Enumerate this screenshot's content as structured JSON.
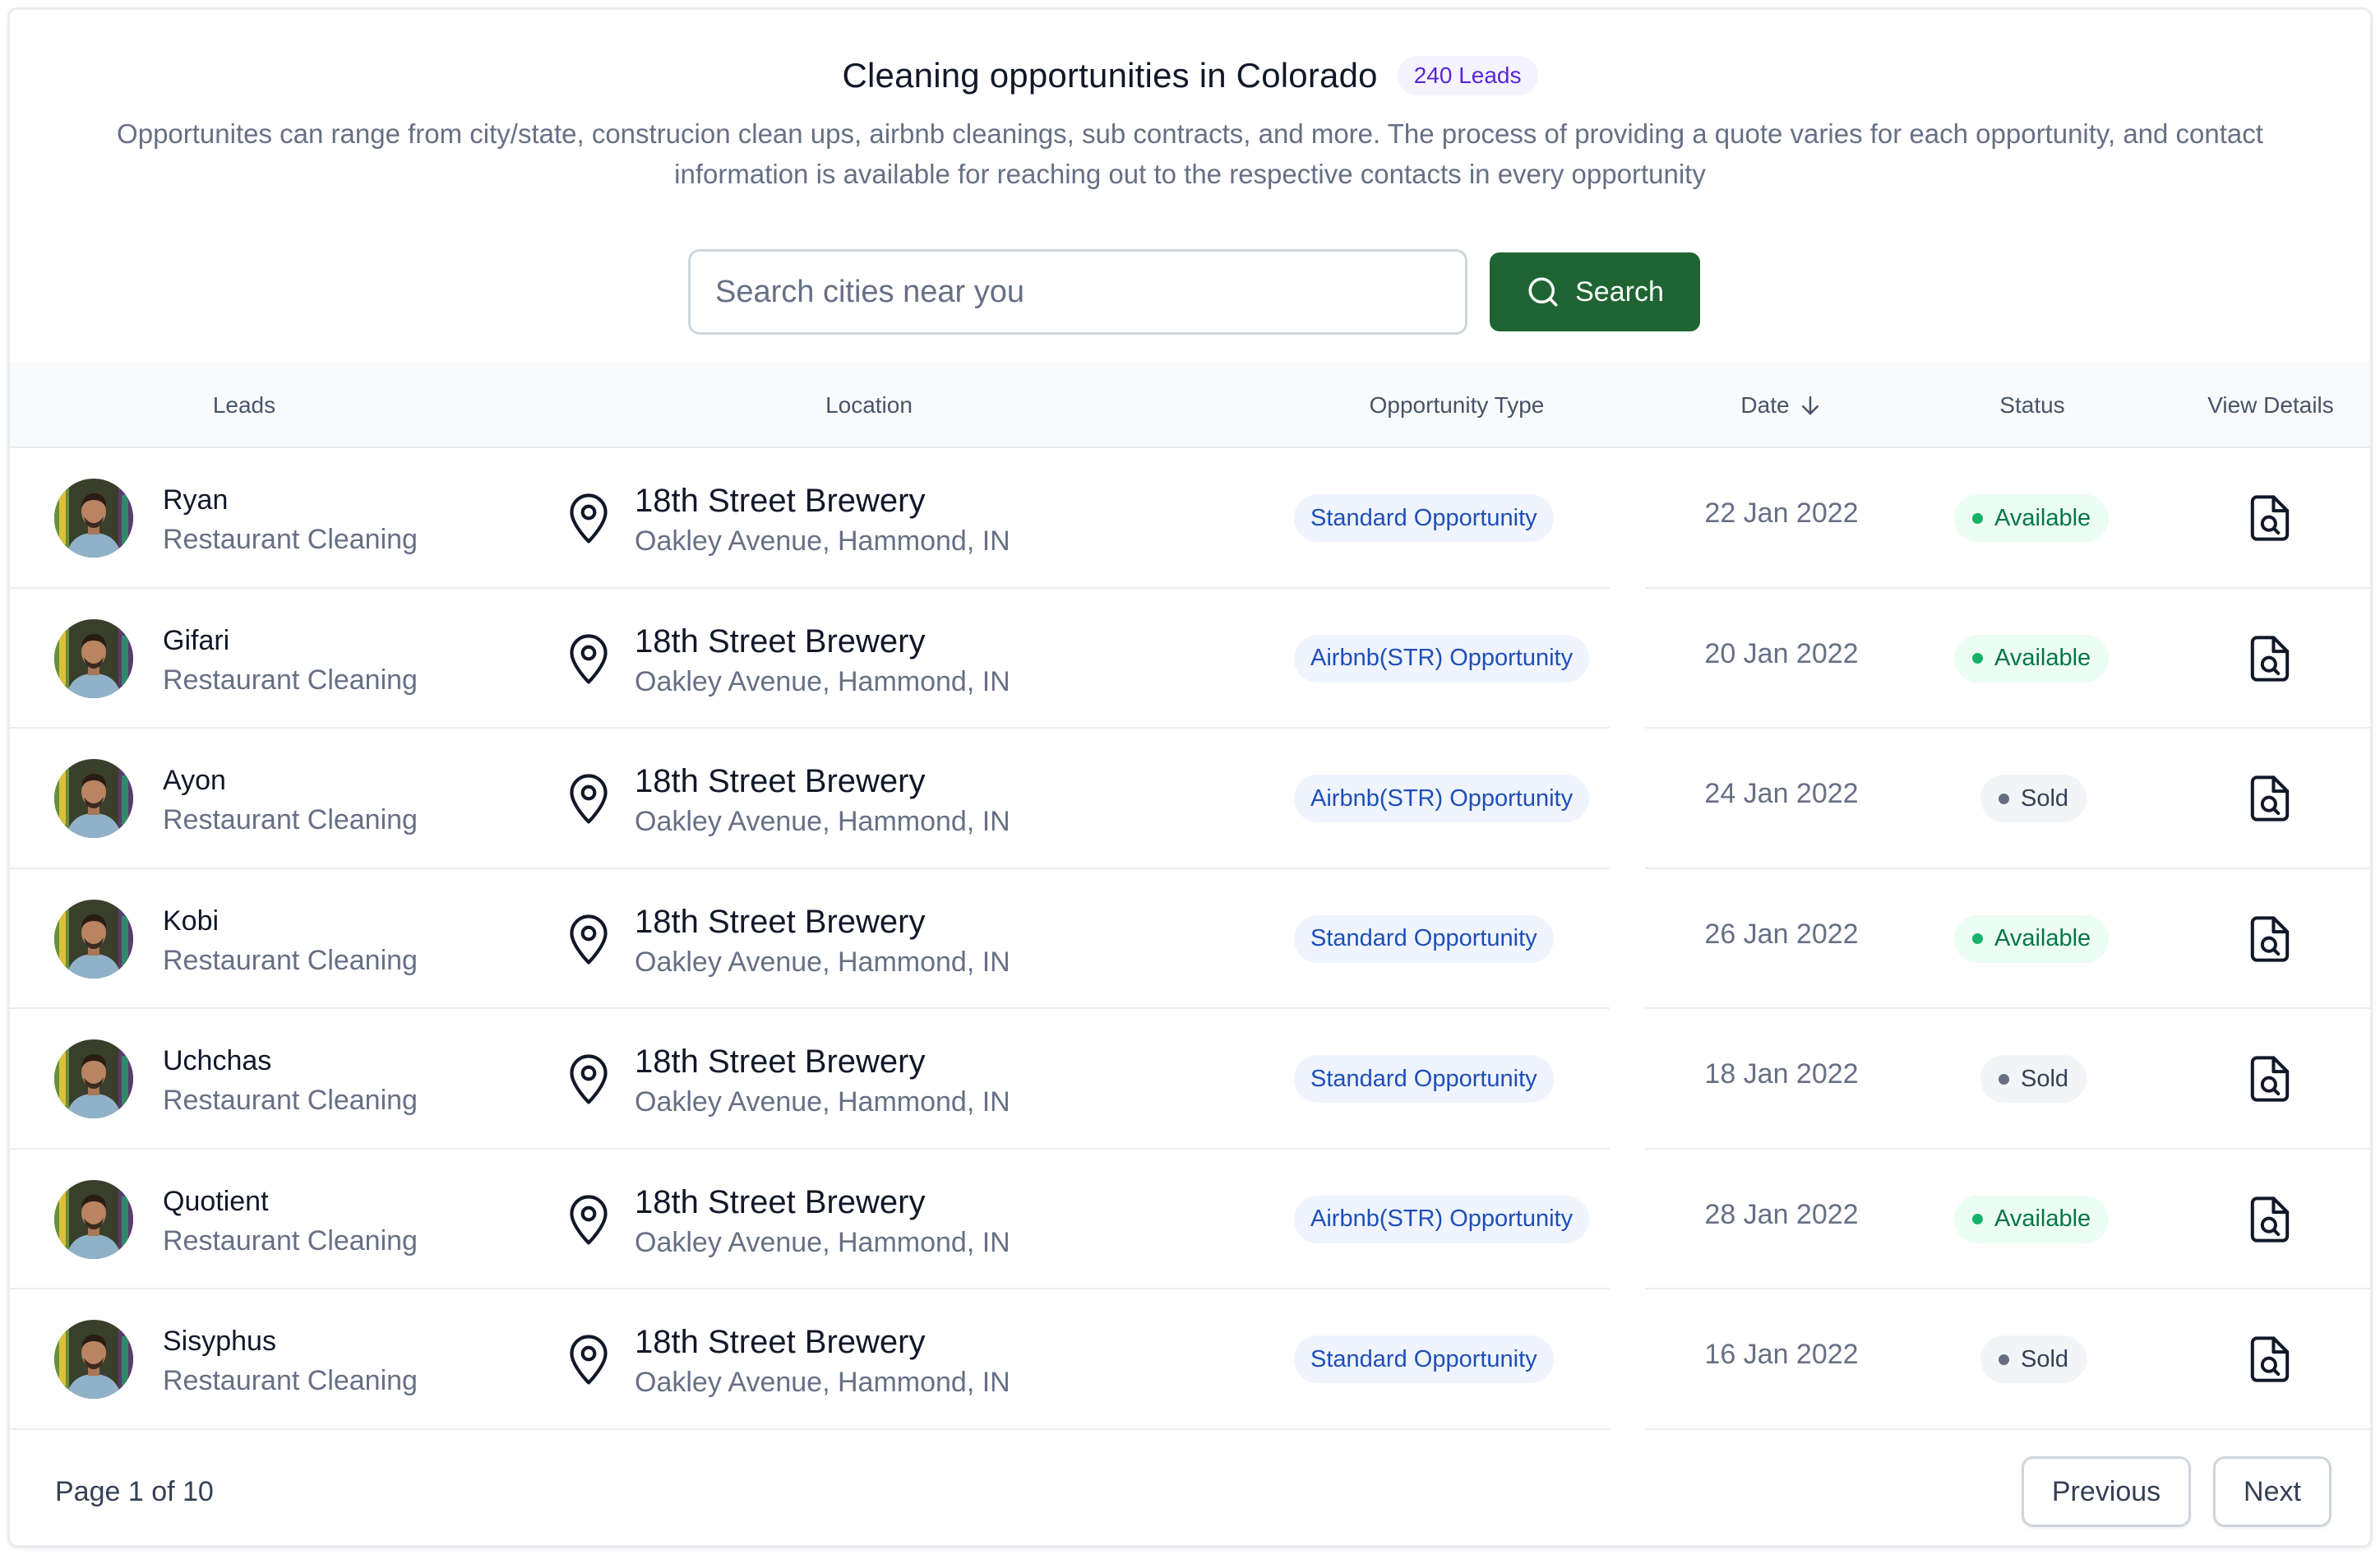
{
  "header": {
    "title": "Cleaning opportunities in Colorado",
    "badge": "240 Leads",
    "description": "Opportunites can range from city/state, construcion clean ups, airbnb cleanings, sub contracts, and more. The process of providing a quote varies for each opportunity, and contact information is available for reaching out to the respective contacts in every opportunity"
  },
  "search": {
    "placeholder": "Search cities near you",
    "value": "",
    "button_label": "Search",
    "button_icon": "search-icon"
  },
  "table": {
    "columns": {
      "leads": "Leads",
      "location": "Location",
      "opportunity_type": "Opportunity Type",
      "date": "Date",
      "status": "Status",
      "view_details": "View Details"
    },
    "date_sort_icon": "arrow-down-icon",
    "rows": [
      {
        "name": "Ryan",
        "subtitle": "Restaurant Cleaning",
        "location": "18th Street Brewery",
        "address": "Oakley Avenue, Hammond, IN",
        "type": "Standard Opportunity",
        "date": "22 Jan 2022",
        "status": "Available"
      },
      {
        "name": "Gifari",
        "subtitle": "Restaurant Cleaning",
        "location": "18th Street Brewery",
        "address": "Oakley Avenue, Hammond, IN",
        "type": "Airbnb(STR) Opportunity",
        "date": "20 Jan 2022",
        "status": "Available"
      },
      {
        "name": "Ayon",
        "subtitle": "Restaurant Cleaning",
        "location": "18th Street Brewery",
        "address": "Oakley Avenue, Hammond, IN",
        "type": "Airbnb(STR) Opportunity",
        "date": "24 Jan 2022",
        "status": "Sold"
      },
      {
        "name": "Kobi",
        "subtitle": "Restaurant Cleaning",
        "location": "18th Street Brewery",
        "address": "Oakley Avenue, Hammond, IN",
        "type": "Standard Opportunity",
        "date": "26 Jan 2022",
        "status": "Available"
      },
      {
        "name": "Uchchas",
        "subtitle": "Restaurant Cleaning",
        "location": "18th Street Brewery",
        "address": "Oakley Avenue, Hammond, IN",
        "type": "Standard Opportunity",
        "date": "18 Jan 2022",
        "status": "Sold"
      },
      {
        "name": "Quotient",
        "subtitle": "Restaurant Cleaning",
        "location": "18th Street Brewery",
        "address": "Oakley Avenue, Hammond, IN",
        "type": "Airbnb(STR) Opportunity",
        "date": "28 Jan 2022",
        "status": "Available"
      },
      {
        "name": "Sisyphus",
        "subtitle": "Restaurant Cleaning",
        "location": "18th Street Brewery",
        "address": "Oakley Avenue, Hammond, IN",
        "type": "Standard Opportunity",
        "date": "16 Jan 2022",
        "status": "Sold"
      }
    ]
  },
  "pagination": {
    "page_info": "Page 1 of 10",
    "previous_label": "Previous",
    "next_label": "Next"
  },
  "colors": {
    "brand_green": "#1f6433",
    "badge_purple_bg": "#f4f3ff",
    "badge_purple_text": "#5925dc",
    "opportunity_bg": "#eff4ff",
    "opportunity_text": "#1e4fb8",
    "available_bg": "#ecfdf3",
    "available_text": "#067647",
    "sold_bg": "#f2f4f7",
    "sold_text": "#344054"
  },
  "icons": {
    "row_avatar": "avatar",
    "location": "map-pin-icon",
    "view": "file-search-icon"
  }
}
